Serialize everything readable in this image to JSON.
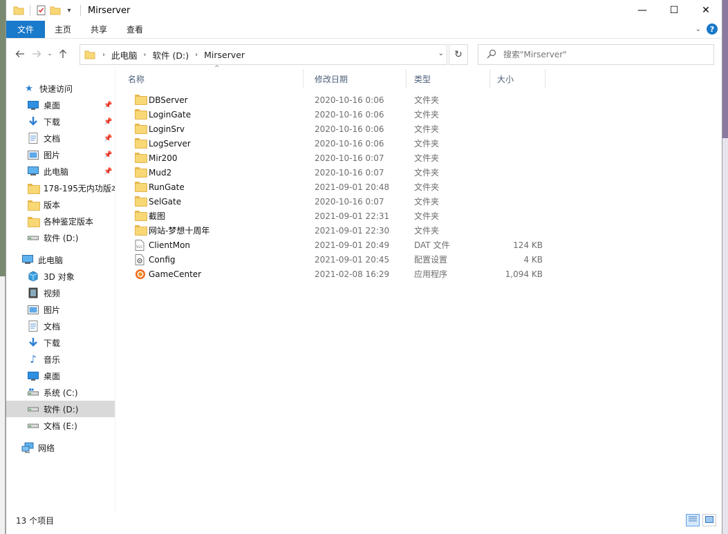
{
  "window": {
    "title": "Mirserver",
    "minimize": "—",
    "maximize": "☐",
    "close": "✕"
  },
  "ribbon": {
    "tabs": [
      "文件",
      "主页",
      "共享",
      "查看"
    ]
  },
  "address": {
    "crumbs": [
      "此电脑",
      "软件 (D:)",
      "Mirserver"
    ]
  },
  "search": {
    "placeholder": "搜索\"Mirserver\""
  },
  "nav": {
    "quick_access": "快速访问",
    "quick_items": [
      "桌面",
      "下载",
      "文档",
      "图片",
      "此电脑",
      "178-195无内功版本",
      "版本",
      "各种鉴定版本",
      "软件 (D:)"
    ],
    "this_pc": "此电脑",
    "pc_items": [
      "3D 对象",
      "视频",
      "图片",
      "文档",
      "下载",
      "音乐",
      "桌面",
      "系统 (C:)",
      "软件 (D:)",
      "文档 (E:)"
    ],
    "network": "网络"
  },
  "columns": {
    "name": "名称",
    "date": "修改日期",
    "type": "类型",
    "size": "大小"
  },
  "files": [
    {
      "name": "DBServer",
      "date": "2020-10-16 0:06",
      "type": "文件夹",
      "size": "",
      "icon": "folder-icon"
    },
    {
      "name": "LoginGate",
      "date": "2020-10-16 0:06",
      "type": "文件夹",
      "size": "",
      "icon": "folder-icon"
    },
    {
      "name": "LoginSrv",
      "date": "2020-10-16 0:06",
      "type": "文件夹",
      "size": "",
      "icon": "folder-icon"
    },
    {
      "name": "LogServer",
      "date": "2020-10-16 0:06",
      "type": "文件夹",
      "size": "",
      "icon": "folder-icon"
    },
    {
      "name": "Mir200",
      "date": "2020-10-16 0:07",
      "type": "文件夹",
      "size": "",
      "icon": "folder-icon"
    },
    {
      "name": "Mud2",
      "date": "2020-10-16 0:07",
      "type": "文件夹",
      "size": "",
      "icon": "folder-icon"
    },
    {
      "name": "RunGate",
      "date": "2021-09-01 20:48",
      "type": "文件夹",
      "size": "",
      "icon": "folder-icon"
    },
    {
      "name": "SelGate",
      "date": "2020-10-16 0:07",
      "type": "文件夹",
      "size": "",
      "icon": "folder-icon"
    },
    {
      "name": "截图",
      "date": "2021-09-01 22:31",
      "type": "文件夹",
      "size": "",
      "icon": "folder-icon"
    },
    {
      "name": "网站-梦想十周年",
      "date": "2021-09-01 22:30",
      "type": "文件夹",
      "size": "",
      "icon": "folder-icon"
    },
    {
      "name": "ClientMon",
      "date": "2021-09-01 20:49",
      "type": "DAT 文件",
      "size": "124 KB",
      "icon": "dat-file-icon"
    },
    {
      "name": "Config",
      "date": "2021-09-01 20:45",
      "type": "配置设置",
      "size": "4 KB",
      "icon": "config-file-icon"
    },
    {
      "name": "GameCenter",
      "date": "2021-02-08 16:29",
      "type": "应用程序",
      "size": "1,094 KB",
      "icon": "app-icon"
    }
  ],
  "status": {
    "count": "13 个项目"
  }
}
